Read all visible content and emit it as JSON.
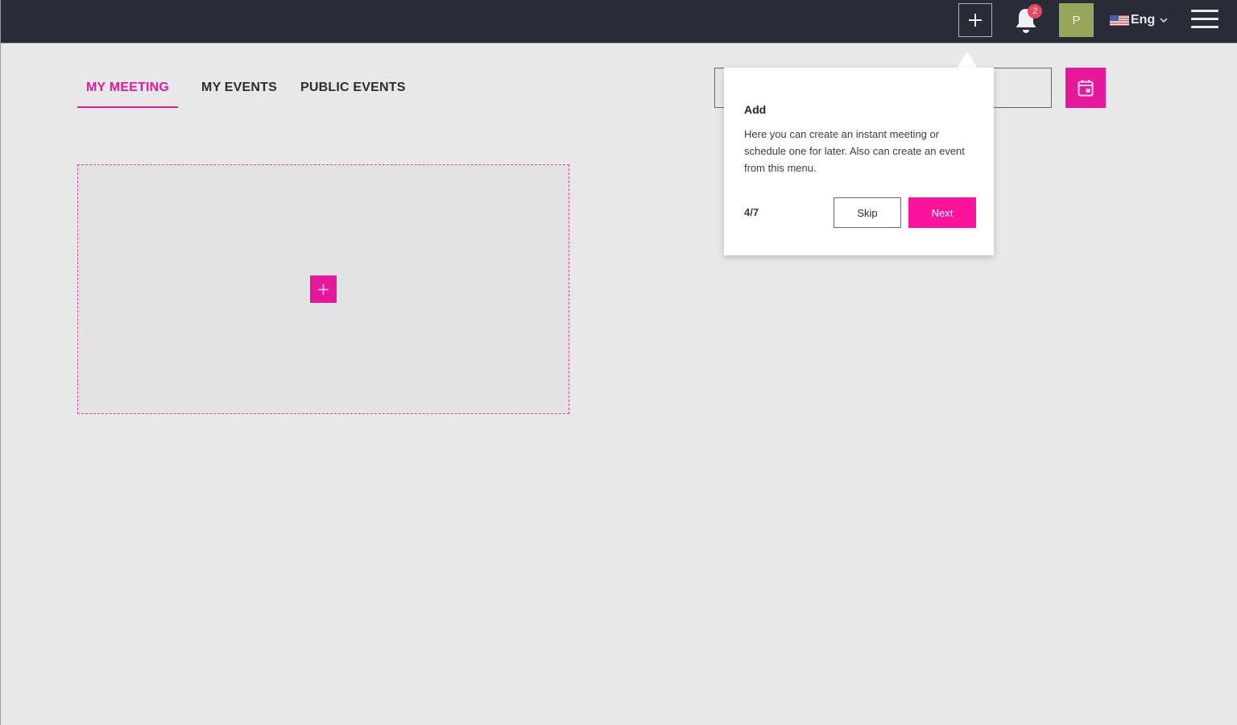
{
  "header": {
    "add_icon": "plus-icon",
    "notifications": {
      "icon": "bell-icon",
      "count": "2"
    },
    "avatar_initial": "P",
    "language": {
      "flag": "us-flag-icon",
      "label": "Eng",
      "chevron": "chevron-down-icon"
    },
    "menu_icon": "hamburger-menu-icon"
  },
  "tabs": [
    {
      "label": "MY MEETING",
      "active": true
    },
    {
      "label": "MY EVENTS",
      "active": false
    },
    {
      "label": "PUBLIC EVENTS",
      "active": false
    }
  ],
  "search": {
    "value": "",
    "placeholder": ""
  },
  "calendar_button": {
    "icon": "calendar-icon"
  },
  "dropzone": {
    "add_icon": "plus-icon"
  },
  "tour": {
    "title": "Add",
    "body": "Here you can create an instant meeting or schedule one for later. Also can create an event from this menu.",
    "step": "4/7",
    "skip_label": "Skip",
    "next_label": "Next"
  },
  "colors": {
    "accent": "#e5179a",
    "header_bg": "#272c36",
    "page_bg": "#e8e8e8",
    "avatar_bg": "#98a65c",
    "badge": "#e8485f"
  }
}
